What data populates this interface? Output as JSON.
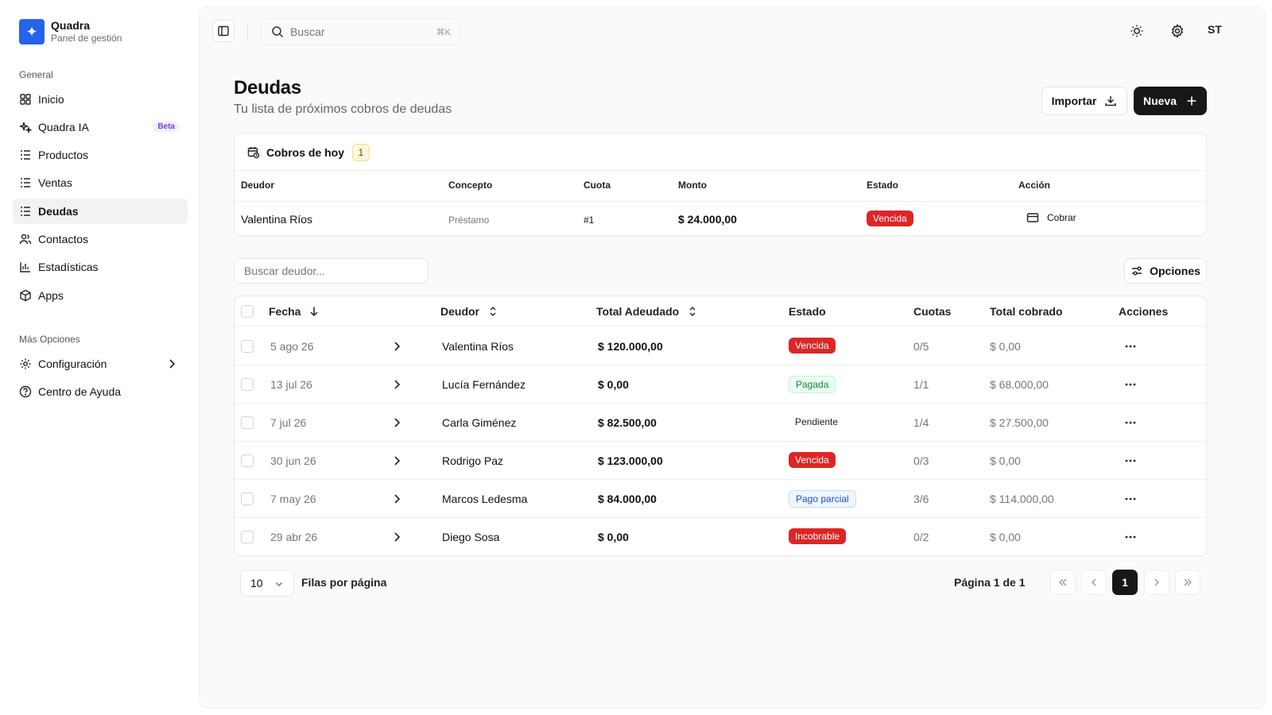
{
  "brand": {
    "name": "Quadra",
    "subtitle": "Panel de gestión"
  },
  "sidebar": {
    "section_general": "General",
    "items": [
      {
        "label": "Inicio",
        "icon": "grid-icon"
      },
      {
        "label": "Quadra IA",
        "icon": "sparkles-icon",
        "badge": "Beta"
      },
      {
        "label": "Productos",
        "icon": "list-icon"
      },
      {
        "label": "Ventas",
        "icon": "list-icon"
      },
      {
        "label": "Deudas",
        "icon": "list-icon",
        "active": true
      },
      {
        "label": "Contactos",
        "icon": "users-icon"
      },
      {
        "label": "Estadísticas",
        "icon": "bar-chart-icon"
      },
      {
        "label": "Apps",
        "icon": "box-icon"
      }
    ],
    "section_more": "Más Opciones",
    "more_items": [
      {
        "label": "Configuración",
        "icon": "gear-icon"
      },
      {
        "label": "Centro de Ayuda",
        "icon": "help-circle-icon"
      }
    ]
  },
  "topbar": {
    "search_placeholder": "Buscar",
    "search_shortcut": "⌘K",
    "avatar": "ST"
  },
  "page": {
    "title": "Deudas",
    "subtitle": "Tu lista de próximos cobros de deudas",
    "import_label": "Importar",
    "new_label": "Nueva"
  },
  "today": {
    "title": "Cobros de hoy",
    "count": "1",
    "headers": [
      "Deudor",
      "Concepto",
      "Cuota",
      "Monto",
      "Estado",
      "Acción"
    ],
    "row": {
      "deudor": "Valentina Ríos",
      "concepto": "Préstamo",
      "cuota": "#1",
      "monto": "$ 24.000,00",
      "estado": "Vencida",
      "accion": "Cobrar"
    }
  },
  "filters": {
    "search_placeholder": "Buscar deudor...",
    "options_label": "Opciones"
  },
  "table": {
    "headers": {
      "fecha": "Fecha",
      "deudor": "Deudor",
      "total": "Total Adeudado",
      "estado": "Estado",
      "cuotas": "Cuotas",
      "cobrado": "Total cobrado",
      "acciones": "Acciones"
    },
    "rows": [
      {
        "fecha": "5 ago 26",
        "deudor": "Valentina Ríos",
        "total": "$ 120.000,00",
        "estado": "Vencida",
        "cuotas": "0/5",
        "cobrado": "$ 0,00"
      },
      {
        "fecha": "13 jul 26",
        "deudor": "Lucía Fernández",
        "total": "$ 0,00",
        "estado": "Pagada",
        "cuotas": "1/1",
        "cobrado": "$ 68.000,00"
      },
      {
        "fecha": "7 jul 26",
        "deudor": "Carla Giménez",
        "total": "$ 82.500,00",
        "estado": "Pendiente",
        "cuotas": "1/4",
        "cobrado": "$ 27.500,00"
      },
      {
        "fecha": "30 jun 26",
        "deudor": "Rodrigo Paz",
        "total": "$ 123.000,00",
        "estado": "Vencida",
        "cuotas": "0/3",
        "cobrado": "$ 0,00"
      },
      {
        "fecha": "7 may 26",
        "deudor": "Marcos Ledesma",
        "total": "$ 84.000,00",
        "estado": "Pago parcial",
        "cuotas": "3/6",
        "cobrado": "$ 114.000,00"
      },
      {
        "fecha": "29 abr 26",
        "deudor": "Diego Sosa",
        "total": "$ 0,00",
        "estado": "Incobrable",
        "cuotas": "0/2",
        "cobrado": "$ 0,00"
      }
    ]
  },
  "pagination": {
    "rows_per_page": "10",
    "rows_label": "Filas por página",
    "page_info": "Página 1 de 1",
    "current_page": "1"
  },
  "colors": {
    "accent": "#2563eb",
    "danger": "#dc2626",
    "dark": "#171717"
  }
}
